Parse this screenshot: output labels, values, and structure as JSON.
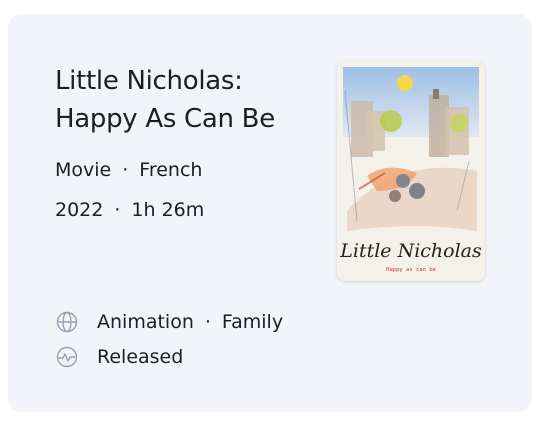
{
  "title": "Little Nicholas: Happy As Can Be",
  "meta": {
    "type": "Movie",
    "language": "French",
    "year": "2022",
    "runtime": "1h 26m",
    "separator": "·"
  },
  "poster": {
    "script_title": "Little Nicholas",
    "tagline": "Happy as can be"
  },
  "info": {
    "genres": [
      "Animation",
      "Family"
    ],
    "status": "Released",
    "genre_icon": "globe-icon",
    "status_icon": "pulse-icon"
  }
}
